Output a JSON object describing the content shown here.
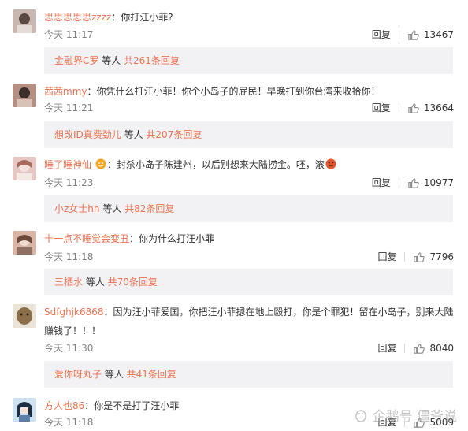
{
  "comments": [
    {
      "username": "思思思思思zzzz",
      "text": "：你打汪小菲?",
      "time": "今天 11:17",
      "reply_label": "回复",
      "likes": "13467",
      "sub_user": "金融界C罗",
      "sub_mid": " 等人 ",
      "sub_count": "共261条回复",
      "avatar_color": "#c7b7b0"
    },
    {
      "username": "茜茜mmy",
      "text": "：你凭什么打汪小菲！你个小岛子的屁民！早晚打到你台湾来收拾你！",
      "time": "今天 11:21",
      "reply_label": "回复",
      "likes": "13664",
      "sub_user": "想改ID真费劲儿",
      "sub_mid": " 等人 ",
      "sub_count": "共207条回复",
      "avatar_color": "#b48f82"
    },
    {
      "username": "睡了睡神仙",
      "text": "：封杀小岛子陈建州，以后别想来大陆捞金。呸，滚",
      "time": "今天 11:23",
      "reply_label": "回复",
      "likes": "10977",
      "sub_user": "小z女士hh",
      "sub_mid": " 等人 ",
      "sub_count": "共82条回复",
      "avatar_color": "#e6c7c4"
    },
    {
      "username": "十一点不睡觉会变丑",
      "text": "：你为什么打汪小菲",
      "time": "今天 11:18",
      "reply_label": "回复",
      "likes": "7796",
      "sub_user": "三栖水",
      "sub_mid": " 等人 ",
      "sub_count": "共70条回复",
      "avatar_color": "#d9b5a6"
    },
    {
      "username": "Sdfghjk6868",
      "text": "：因为汪小菲爱国，你把汪小菲摁在地上殴打，你是个罪犯！留在小岛子，别来大陆赚钱了！！！",
      "time": "今天 11:30",
      "reply_label": "回复",
      "likes": "8040",
      "sub_user": "爱你呀丸子",
      "sub_mid": " 等人 ",
      "sub_count": "共41条回复",
      "avatar_color": "#8b6f4a"
    },
    {
      "username": "方人也86",
      "text": "：你是不是打了汪小菲",
      "time": "今天 11:18",
      "reply_label": "回复",
      "likes": "5009",
      "avatar_color": "#5b7fa8"
    }
  ],
  "watermark": "企鹅号 僵爷说",
  "colors": {
    "link": "#eb7350",
    "sub_bg": "#f2f2f5",
    "meta": "#808080"
  },
  "icons": {
    "like": "thumbs-up-icon",
    "badge": "member-badge-icon",
    "emoji": "angry-face-icon"
  }
}
